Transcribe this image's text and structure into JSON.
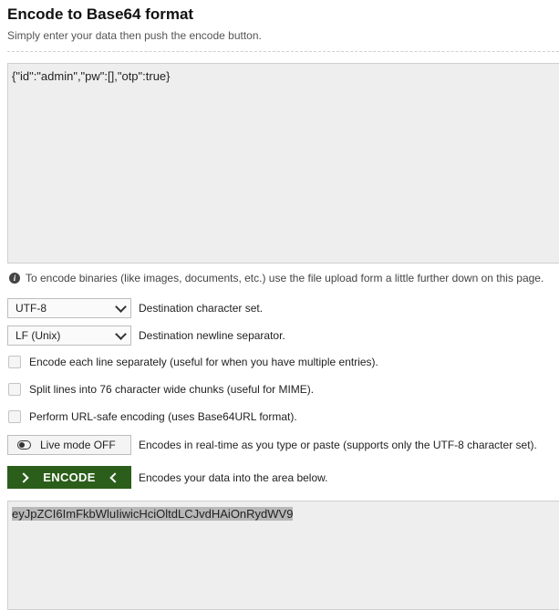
{
  "header": {
    "title": "Encode to Base64 format",
    "subtitle": "Simply enter your data then push the encode button."
  },
  "input": {
    "value": "{\"id\":\"admin\",\"pw\":[],\"otp\":true}"
  },
  "info": {
    "text": "To encode binaries (like images, documents, etc.) use the file upload form a little further down on this page."
  },
  "options": {
    "charset": {
      "value": "UTF-8",
      "label": "Destination character set."
    },
    "newline": {
      "value": "LF (Unix)",
      "label": "Destination newline separator."
    },
    "each_line": {
      "label": "Encode each line separately (useful for when you have multiple entries).",
      "checked": false
    },
    "split_lines": {
      "label": "Split lines into 76 character wide chunks (useful for MIME).",
      "checked": false
    },
    "url_safe": {
      "label": "Perform URL-safe encoding (uses Base64URL format).",
      "checked": false
    },
    "live_mode": {
      "button": "Live mode OFF",
      "label": "Encodes in real-time as you type or paste (supports only the UTF-8 character set)."
    }
  },
  "encode": {
    "button": "ENCODE",
    "label": "Encodes your data into the area below."
  },
  "output": {
    "value": "eyJpZCI6ImFkbWluIiwicHciOltdLCJvdHAiOnRydWV9"
  },
  "colors": {
    "encode_button": "#2b5e1a",
    "textarea_bg": "#eeeeee"
  }
}
